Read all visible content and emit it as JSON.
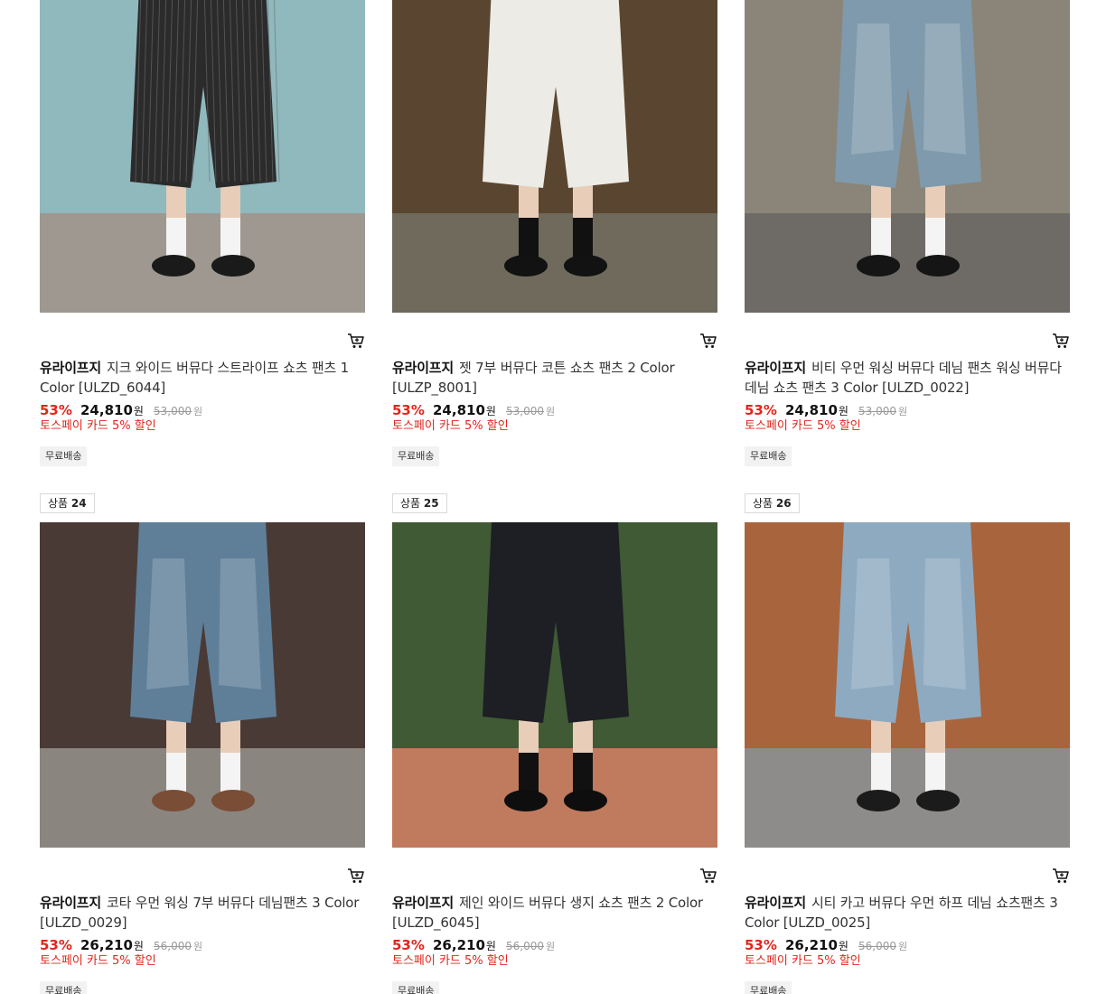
{
  "products": [
    {
      "badge_prefix": "",
      "badge_number": "",
      "brand": "유라이프지",
      "name": "지크 와이드 버뮤다 스트라이프 쇼츠 팬츠 1 Color [ULZD_6044]",
      "discount": "53%",
      "sale_price": "24,810",
      "currency": "원",
      "original_price": "53,000",
      "original_currency": "원",
      "promo": "토스페이 카드 5% 할인",
      "shipping": "무료배송",
      "image": {
        "bg": "#8fb9bd",
        "pants": "#2b2b2b",
        "pattern": "stripe",
        "floor": "#9e9890",
        "shoes": "#1a1a1a"
      }
    },
    {
      "badge_prefix": "",
      "badge_number": "",
      "brand": "유라이프지",
      "name": "젯 7부 버뮤다 코튼 쇼츠 팬츠 2 Color [ULZP_8001]",
      "discount": "53%",
      "sale_price": "24,810",
      "currency": "원",
      "original_price": "53,000",
      "original_currency": "원",
      "promo": "토스페이 카드 5% 할인",
      "shipping": "무료배송",
      "image": {
        "bg": "#5a4630",
        "pants": "#ecebe6",
        "pattern": "plain",
        "floor": "#6f6a5c",
        "shoes": "#121212"
      }
    },
    {
      "badge_prefix": "",
      "badge_number": "",
      "brand": "유라이프지",
      "name": "비티 우먼 워싱 버뮤다 데님 팬츠 워싱 버뮤다 데님 쇼츠 팬츠 3 Color [ULZD_0022]",
      "discount": "53%",
      "sale_price": "24,810",
      "currency": "원",
      "original_price": "53,000",
      "original_currency": "원",
      "promo": "토스페이 카드 5% 할인",
      "shipping": "무료배송",
      "image": {
        "bg": "#8a8578",
        "pants": "#7f9aad",
        "pattern": "denim",
        "floor": "#6e6b66",
        "shoes": "#151515"
      }
    },
    {
      "badge_prefix": "상품",
      "badge_number": "24",
      "brand": "유라이프지",
      "name": "코타 우먼 워싱 7부 버뮤다 데님팬츠 3 Color [ULZD_0029]",
      "discount": "53%",
      "sale_price": "26,210",
      "currency": "원",
      "original_price": "56,000",
      "original_currency": "원",
      "promo": "토스페이 카드 5% 할인",
      "shipping": "무료배송",
      "image": {
        "bg": "#4a3a35",
        "pants": "#5f7f99",
        "pattern": "denim",
        "floor": "#8a857f",
        "shoes": "#7a4d36"
      }
    },
    {
      "badge_prefix": "상품",
      "badge_number": "25",
      "brand": "유라이프지",
      "name": "제인 와이드 버뮤다 생지 쇼츠 팬츠 2 Color [ULZD_6045]",
      "discount": "53%",
      "sale_price": "26,210",
      "currency": "원",
      "original_price": "56,000",
      "original_currency": "원",
      "promo": "토스페이 카드 5% 할인",
      "shipping": "무료배송",
      "image": {
        "bg": "#3f5a34",
        "pants": "#1d1f24",
        "pattern": "plain",
        "floor": "#c07a5e",
        "shoes": "#0e0e0e"
      }
    },
    {
      "badge_prefix": "상품",
      "badge_number": "26",
      "brand": "유라이프지",
      "name": "시티 카고 버뮤다 우먼 하프 데님 쇼츠팬츠 3 Color [ULZD_0025]",
      "discount": "53%",
      "sale_price": "26,210",
      "currency": "원",
      "original_price": "56,000",
      "original_currency": "원",
      "promo": "토스페이 카드 5% 할인",
      "shipping": "무료배송",
      "image": {
        "bg": "#a8643c",
        "pants": "#8eaac0",
        "pattern": "denim",
        "floor": "#8e8c8a",
        "shoes": "#1b1b1b"
      }
    }
  ]
}
